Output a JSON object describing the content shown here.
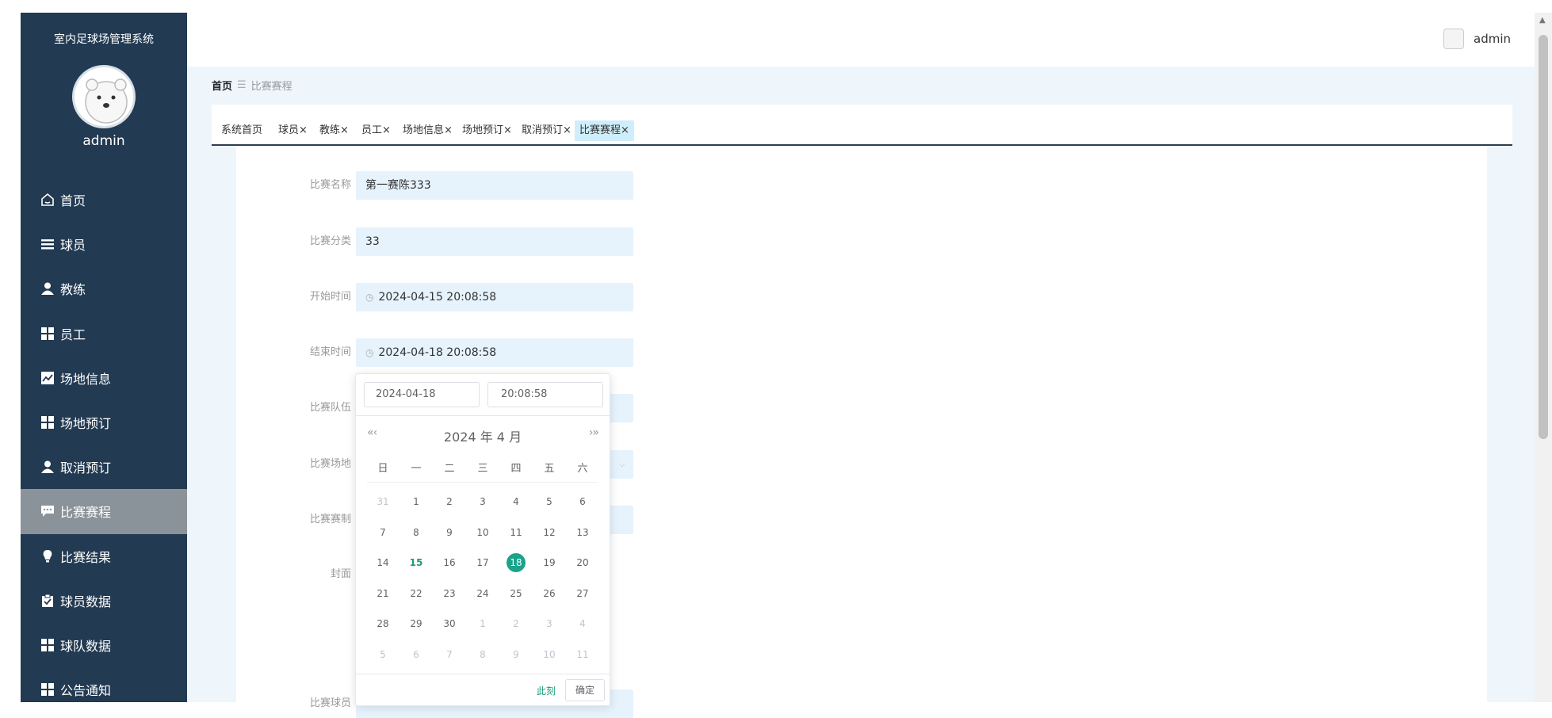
{
  "sidebar": {
    "title": "室内足球场管理系统",
    "user": "admin",
    "items": [
      {
        "label": "首页",
        "icon": "home-icon"
      },
      {
        "label": "球员",
        "icon": "list-icon"
      },
      {
        "label": "教练",
        "icon": "person-icon"
      },
      {
        "label": "员工",
        "icon": "grid-icon"
      },
      {
        "label": "场地信息",
        "icon": "chart-icon"
      },
      {
        "label": "场地预订",
        "icon": "grid-icon"
      },
      {
        "label": "取消预订",
        "icon": "person-icon"
      },
      {
        "label": "比赛赛程",
        "icon": "chat-icon"
      },
      {
        "label": "比赛结果",
        "icon": "bulb-icon"
      },
      {
        "label": "球员数据",
        "icon": "clipboard-icon"
      },
      {
        "label": "球队数据",
        "icon": "grid-icon"
      },
      {
        "label": "公告通知",
        "icon": "grid-icon"
      }
    ],
    "active_index": 7
  },
  "topbar": {
    "user": "admin"
  },
  "breadcrumb": {
    "home": "首页",
    "current": "比赛赛程"
  },
  "tabs": [
    {
      "label": "系统首页"
    },
    {
      "label": "球员×"
    },
    {
      "label": "教练×"
    },
    {
      "label": "员工×"
    },
    {
      "label": "场地信息×"
    },
    {
      "label": "场地预订×"
    },
    {
      "label": "取消预订×"
    },
    {
      "label": "比赛赛程×"
    }
  ],
  "form": {
    "name_label": "比赛名称",
    "name_value": "第一赛陈333",
    "category_label": "比赛分类",
    "category_value": "33",
    "start_label": "开始时间",
    "start_value": "2024-04-15 20:08:58",
    "end_label": "结束时间",
    "end_value": "2024-04-18 20:08:58",
    "team_label": "比赛队伍",
    "venue_label": "比赛场地",
    "format_label": "比赛赛制",
    "cover_label": "封面",
    "players_label": "比赛球员"
  },
  "picker": {
    "date_input": "2024-04-18",
    "time_input": "20:08:58",
    "prev": "«‹",
    "next": "›»",
    "title": "2024 年 4 月",
    "weekdays": [
      "日",
      "一",
      "二",
      "三",
      "四",
      "五",
      "六"
    ],
    "weeks": [
      [
        "31",
        "1",
        "2",
        "3",
        "4",
        "5",
        "6"
      ],
      [
        "7",
        "8",
        "9",
        "10",
        "11",
        "12",
        "13"
      ],
      [
        "14",
        "15",
        "16",
        "17",
        "18",
        "19",
        "20"
      ],
      [
        "21",
        "22",
        "23",
        "24",
        "25",
        "26",
        "27"
      ],
      [
        "28",
        "29",
        "30",
        "1",
        "2",
        "3",
        "4"
      ],
      [
        "5",
        "6",
        "7",
        "8",
        "9",
        "10",
        "11"
      ]
    ],
    "today": "15",
    "selected": "18",
    "now_label": "此刻",
    "ok_label": "确定"
  },
  "colors": {
    "sidebar": "#223a52",
    "active_menu": "#8a9399",
    "accent": "#1aa38a",
    "field_bg": "#e6f3fd"
  }
}
